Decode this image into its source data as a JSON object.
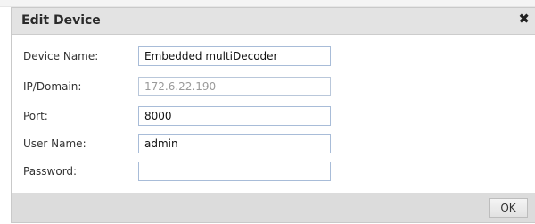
{
  "dialog": {
    "title": "Edit Device",
    "close_icon": "close-icon"
  },
  "form": {
    "device_name": {
      "label": "Device Name:",
      "value": "Embedded multiDecoder"
    },
    "ip_domain": {
      "label": "IP/Domain:",
      "value": "172.6.22.190"
    },
    "port": {
      "label": "Port:",
      "value": "8000"
    },
    "user_name": {
      "label": "User Name:",
      "value": "admin"
    },
    "password": {
      "label": "Password:",
      "value": ""
    }
  },
  "footer": {
    "ok_label": "OK"
  }
}
